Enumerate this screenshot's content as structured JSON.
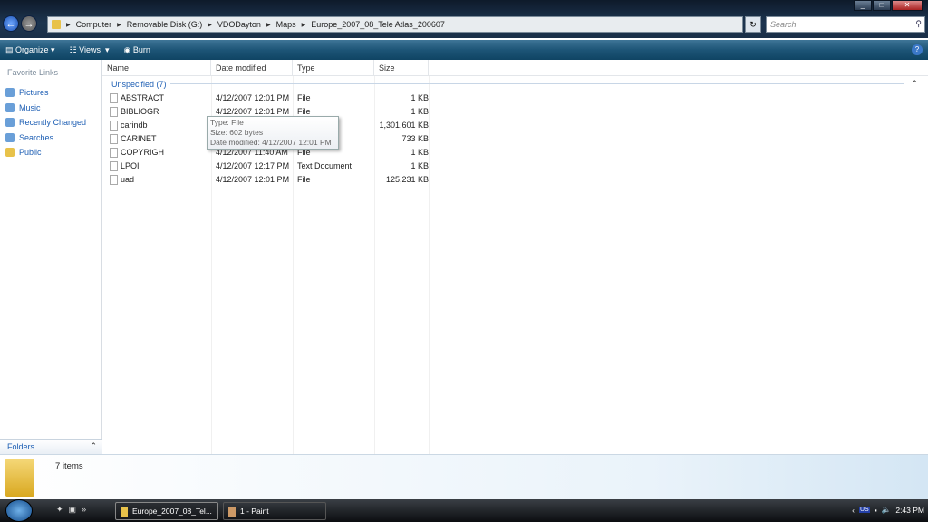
{
  "address": {
    "segments": [
      "Computer",
      "Removable Disk (G:)",
      "VDODayton",
      "Maps",
      "Europe_2007_08_Tele Atlas_200607"
    ]
  },
  "search": {
    "placeholder": "Search"
  },
  "toolbar": {
    "organize": "Organize",
    "views": "Views",
    "burn": "Burn"
  },
  "sidebar": {
    "header": "Favorite Links",
    "items": [
      {
        "label": "Pictures"
      },
      {
        "label": "Music"
      },
      {
        "label": "Recently Changed"
      },
      {
        "label": "Searches"
      },
      {
        "label": "Public"
      }
    ],
    "folders": "Folders"
  },
  "columns": {
    "name": "Name",
    "date": "Date modified",
    "type": "Type",
    "size": "Size"
  },
  "group": "Unspecified (7)",
  "files": [
    {
      "name": "ABSTRACT",
      "date": "4/12/2007 12:01 PM",
      "type": "File",
      "size": "1 KB"
    },
    {
      "name": "BIBLIOGR",
      "date": "4/12/2007 12:01 PM",
      "type": "File",
      "size": "1 KB"
    },
    {
      "name": "carindb",
      "date": "",
      "type": "",
      "size": "1,301,601 KB"
    },
    {
      "name": "CARINET",
      "date": "",
      "type": "",
      "size": "733 KB"
    },
    {
      "name": "COPYRIGH",
      "date": "4/12/2007 11:40 AM",
      "type": "File",
      "size": "1 KB"
    },
    {
      "name": "LPOI",
      "date": "4/12/2007 12:17 PM",
      "type": "Text Document",
      "size": "1 KB"
    },
    {
      "name": "uad",
      "date": "4/12/2007 12:01 PM",
      "type": "File",
      "size": "125,231 KB"
    }
  ],
  "tooltip": {
    "type": "Type: File",
    "size": "Size: 602 bytes",
    "date": "Date modified: 4/12/2007 12:01 PM"
  },
  "details": {
    "count": "7 items"
  },
  "taskbar": {
    "tasks": [
      {
        "label": "Europe_2007_08_Tel..."
      },
      {
        "label": "1 - Paint"
      }
    ],
    "lang": "US",
    "clock": "2:43 PM"
  }
}
